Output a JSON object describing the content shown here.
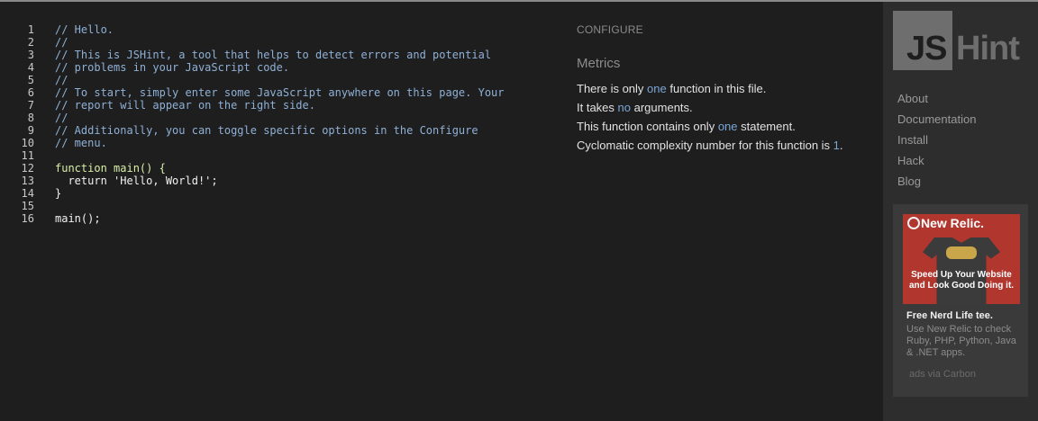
{
  "editor": {
    "line_numbers": [
      "1",
      "2",
      "3",
      "4",
      "5",
      "6",
      "7",
      "8",
      "9",
      "10",
      "11",
      "12",
      "13",
      "14",
      "15",
      "16"
    ],
    "lines": [
      "// Hello.",
      "//",
      "// This is JSHint, a tool that helps to detect errors and potential",
      "// problems in your JavaScript code.",
      "//",
      "// To start, simply enter some JavaScript anywhere on this page. Your",
      "// report will appear on the right side.",
      "//",
      "// Additionally, you can toggle specific options in the Configure",
      "// menu.",
      "",
      "function main() {",
      "  return 'Hello, World!';",
      "}",
      "",
      "main();"
    ]
  },
  "report": {
    "configure_label": "CONFIGURE",
    "metrics_heading": "Metrics",
    "metrics": {
      "line1": {
        "pre": "There is only ",
        "hl": "one",
        "post": " function in this file."
      },
      "line2": {
        "pre": "It takes ",
        "hl": "no",
        "post": " arguments."
      },
      "line3": {
        "pre": "This function contains only ",
        "hl": "one",
        "post": " statement."
      },
      "line4": {
        "pre": "Cyclomatic complexity number for this function is ",
        "hl": "1",
        "post": "."
      }
    },
    "highlight_color": "#7aa6d8"
  },
  "sidebar": {
    "logo": {
      "js": "JS",
      "hint": "Hint"
    },
    "nav": [
      "About",
      "Documentation",
      "Install",
      "Hack",
      "Blog"
    ],
    "ad": {
      "brand": "New Relic.",
      "caption": "Speed Up Your Website and Look Good Doing it.",
      "title": "Free Nerd Life tee.",
      "text": "Use New Relic to check Ruby, PHP, Python, Java & .NET apps.",
      "via": "ads via Carbon"
    }
  }
}
